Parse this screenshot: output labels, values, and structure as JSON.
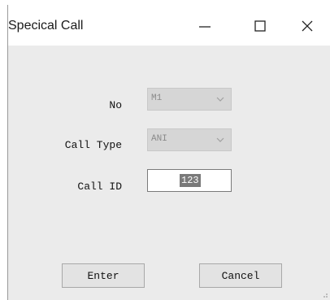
{
  "window": {
    "title": "Specical Call",
    "controls": {
      "minimize_icon": "minimize-icon",
      "maximize_icon": "maximize-icon",
      "close_icon": "close-icon"
    }
  },
  "form": {
    "no": {
      "label": "No",
      "value": "M1"
    },
    "call_type": {
      "label": "Call Type",
      "value": "ANI"
    },
    "call_id": {
      "label": "Call ID",
      "value": "123"
    }
  },
  "buttons": {
    "enter": "Enter",
    "cancel": "Cancel"
  },
  "colors": {
    "window_bg": "#ebebeb",
    "titlebar_bg": "#ffffff",
    "disabled_combo_bg": "#d6d6d6",
    "selection_bg": "#7a7a7a"
  }
}
